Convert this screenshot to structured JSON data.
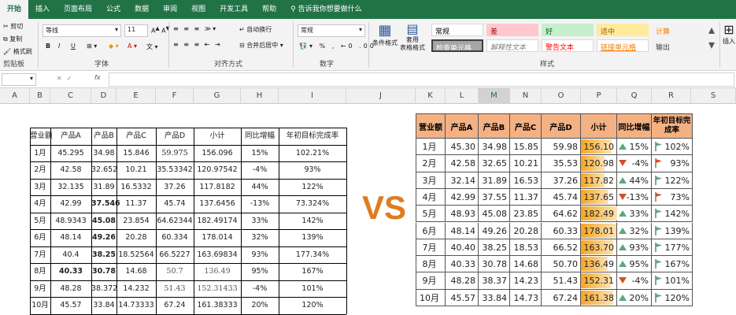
{
  "ribbon": {
    "tabs": [
      "开始",
      "插入",
      "页面布局",
      "公式",
      "数据",
      "审阅",
      "视图",
      "开发工具",
      "帮助"
    ],
    "tell_me": "告诉我你想要做什么",
    "clipboard": {
      "cut": "剪切",
      "copy": "复制",
      "format_painter": "格式刷",
      "label": "剪贴板"
    },
    "font": {
      "name": "等线",
      "size": "11",
      "label": "字体",
      "bold": "B",
      "italic": "I",
      "underline": "U"
    },
    "alignment": {
      "wrap": "自动换行",
      "merge": "合并后居中",
      "label": "对齐方式"
    },
    "number": {
      "format": "常规",
      "label": "数字",
      "percent": "%",
      "comma": ","
    },
    "styles": {
      "cond_format": "条件格式",
      "table_format": "套用\n表格格式",
      "label": "样式",
      "cells": [
        {
          "text": "常规",
          "bg": "#ffffff",
          "fg": "#000000"
        },
        {
          "text": "差",
          "bg": "#ffc7ce",
          "fg": "#9c0006"
        },
        {
          "text": "好",
          "bg": "#c6efce",
          "fg": "#006100"
        },
        {
          "text": "适中",
          "bg": "#ffeb9c",
          "fg": "#9c5700"
        },
        {
          "text": "计算",
          "bg": "#f2f2f2",
          "fg": "#fa7d00"
        },
        {
          "text": "检查单元格",
          "bg": "#a5a5a5",
          "fg": "#ffffff"
        },
        {
          "text": "解释性文本",
          "bg": "#ffffff",
          "fg": "#7f7f7f"
        },
        {
          "text": "警告文本",
          "bg": "#ffffff",
          "fg": "#ff0000"
        },
        {
          "text": "链接单元格",
          "bg": "#ffffff",
          "fg": "#fa7d00"
        },
        {
          "text": "输出",
          "bg": "#f2f2f2",
          "fg": "#3f3f3f"
        }
      ]
    },
    "cells_group": {
      "insert": "插入"
    }
  },
  "formula_bar": {
    "fx": "fx"
  },
  "columns": [
    "A",
    "B",
    "C",
    "D",
    "E",
    "F",
    "G",
    "H",
    "I",
    "J",
    "K",
    "L",
    "M",
    "N",
    "O",
    "P",
    "Q",
    "R",
    "S"
  ],
  "vs_text": "VS",
  "left_table": {
    "headers": [
      "营业额",
      "产品A",
      "产品B",
      "产品C",
      "产品D",
      "小计",
      "同比增幅",
      "年初目标完成率"
    ],
    "rows": [
      [
        "1月",
        "45.295",
        "34.98",
        "15.846",
        "59.975",
        "156.096",
        "15%",
        "102.21%"
      ],
      [
        "2月",
        "42.58",
        "32.652",
        "10.21",
        "35.53342",
        "120.97542",
        "-4%",
        "93%"
      ],
      [
        "3月",
        "32.135",
        "31.89",
        "16.5332",
        "37.26",
        "117.8182",
        "44%",
        "122%"
      ],
      [
        "4月",
        "42.99",
        "37.546",
        "11.37",
        "45.74",
        "137.6456",
        "-13%",
        "73.324%"
      ],
      [
        "5月",
        "48.9343",
        "45.08",
        "23.854",
        "64.62344",
        "182.49174",
        "33%",
        "142%"
      ],
      [
        "6月",
        "48.14",
        "49.26",
        "20.28",
        "60.334",
        "178.014",
        "32%",
        "139%"
      ],
      [
        "7月",
        "40.4",
        "38.25",
        "18.52564",
        "66.5227",
        "163.69834",
        "93%",
        "177.34%"
      ],
      [
        "8月",
        "40.33",
        "30.78",
        "14.68",
        "50.7",
        "136.49",
        "95%",
        "167%"
      ],
      [
        "9月",
        "48.28",
        "38.372",
        "14.232",
        "51.43",
        "152.31433",
        "-4%",
        "101%"
      ],
      [
        "10月",
        "45.57",
        "33.84",
        "14.73333",
        "67.24",
        "161.38333",
        "20%",
        "120%"
      ]
    ]
  },
  "right_table": {
    "headers": [
      "营业额",
      "产品A",
      "产品B",
      "产品C",
      "产品D",
      "小计",
      "同比增幅",
      "年初目标完成率"
    ],
    "rows": [
      {
        "m": "1月",
        "a": "45.30",
        "b": "34.98",
        "c": "15.85",
        "d": "59.98",
        "sub": "156.10",
        "yoy": "15%",
        "dir": "up",
        "rate": "102%",
        "flag": "#5ca87a",
        "sub_v": 156.1
      },
      {
        "m": "2月",
        "a": "42.58",
        "b": "32.65",
        "c": "10.21",
        "d": "35.53",
        "sub": "120.98",
        "yoy": "-4%",
        "dir": "dn",
        "rate": "93%",
        "flag": "#d14f2a",
        "sub_v": 120.98
      },
      {
        "m": "3月",
        "a": "32.14",
        "b": "31.89",
        "c": "16.53",
        "d": "37.26",
        "sub": "117.82",
        "yoy": "44%",
        "dir": "up",
        "rate": "122%",
        "flag": "#5ca87a",
        "sub_v": 117.82
      },
      {
        "m": "4月",
        "a": "42.99",
        "b": "37.55",
        "c": "11.37",
        "d": "45.74",
        "sub": "137.65",
        "yoy": "-13%",
        "dir": "dn",
        "rate": "73%",
        "flag": "#d14f2a",
        "sub_v": 137.65
      },
      {
        "m": "5月",
        "a": "48.93",
        "b": "45.08",
        "c": "23.85",
        "d": "64.62",
        "sub": "182.49",
        "yoy": "33%",
        "dir": "up",
        "rate": "142%",
        "flag": "#5ca87a",
        "sub_v": 182.49
      },
      {
        "m": "6月",
        "a": "48.14",
        "b": "49.26",
        "c": "20.28",
        "d": "60.33",
        "sub": "178.01",
        "yoy": "32%",
        "dir": "up",
        "rate": "139%",
        "flag": "#5ca87a",
        "sub_v": 178.01
      },
      {
        "m": "7月",
        "a": "40.40",
        "b": "38.25",
        "c": "18.53",
        "d": "66.52",
        "sub": "163.70",
        "yoy": "93%",
        "dir": "up",
        "rate": "177%",
        "flag": "#5ca87a",
        "sub_v": 163.7
      },
      {
        "m": "8月",
        "a": "40.33",
        "b": "30.78",
        "c": "14.68",
        "d": "50.70",
        "sub": "136.49",
        "yoy": "95%",
        "dir": "up",
        "rate": "167%",
        "flag": "#5ca87a",
        "sub_v": 136.49
      },
      {
        "m": "9月",
        "a": "48.28",
        "b": "38.37",
        "c": "14.23",
        "d": "51.43",
        "sub": "152.31",
        "yoy": "-4%",
        "dir": "dn",
        "rate": "101%",
        "flag": "#5ca87a",
        "sub_v": 152.31
      },
      {
        "m": "10月",
        "a": "45.57",
        "b": "33.84",
        "c": "14.73",
        "d": "67.24",
        "sub": "161.38",
        "yoy": "20%",
        "dir": "up",
        "rate": "120%",
        "flag": "#5ca87a",
        "sub_v": 161.38
      }
    ]
  },
  "colors": {
    "excel_green": "#217346",
    "header_fill": "#f4b183",
    "databar": "#f5a623",
    "vs": "#e07b20"
  }
}
